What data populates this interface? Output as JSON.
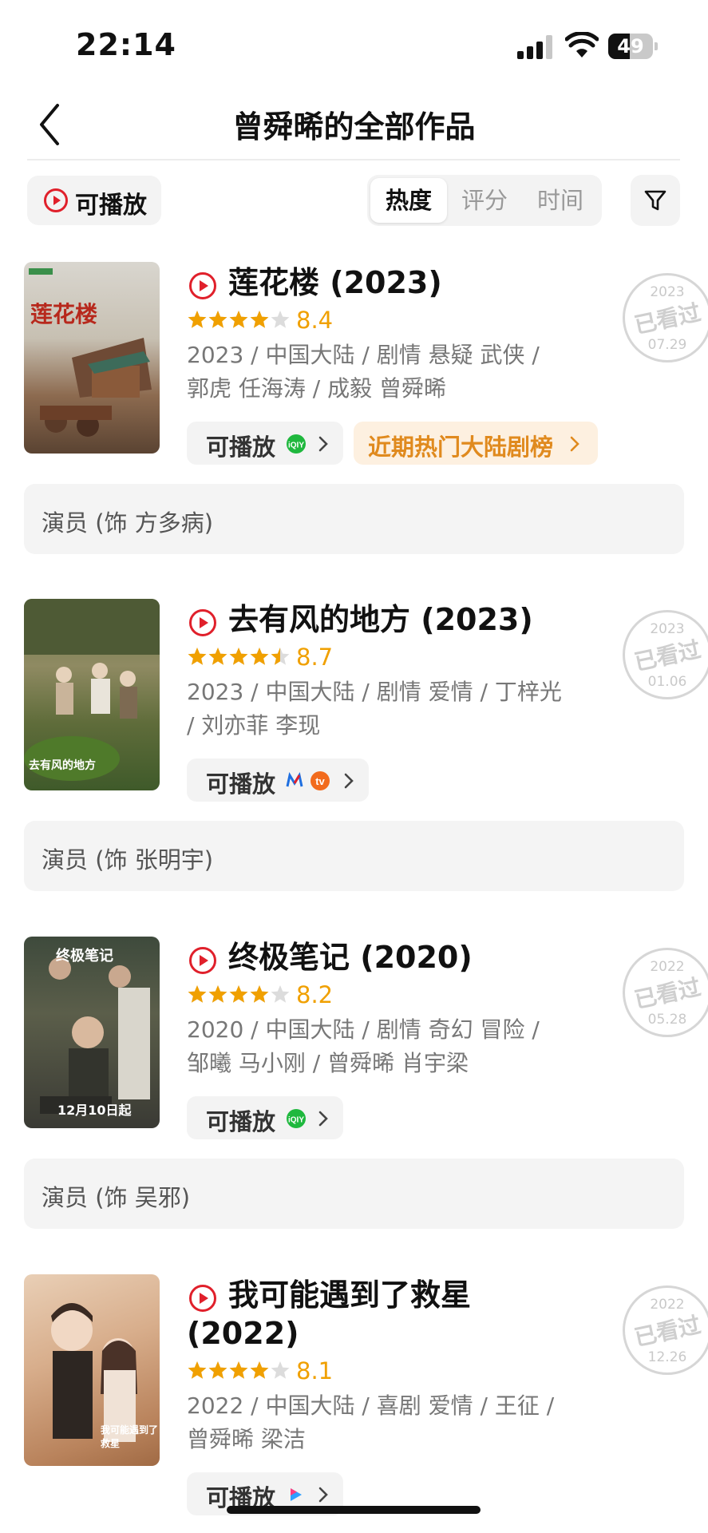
{
  "status_bar": {
    "time": "22:14",
    "battery": "49",
    "battery_level": 0.49
  },
  "nav": {
    "title": "曾舜晞的全部作品"
  },
  "filters": {
    "playable_label": "可播放",
    "sort_tabs": [
      {
        "label": "热度",
        "active": true
      },
      {
        "label": "评分",
        "active": false
      },
      {
        "label": "时间",
        "active": false
      }
    ]
  },
  "works": [
    {
      "title": "莲花楼 (2023)",
      "score": "8.4",
      "stars": 4,
      "meta": "2023 / 中国大陆 / 剧情 悬疑 武侠 / 郭虎 任海涛 / 成毅 曾舜晞",
      "play_label": "可播放",
      "rank_label": "近期热门大陆剧榜",
      "role": "演员 (饰 方多病)",
      "stamp": {
        "year": "2023",
        "text": "已看过",
        "date": "07.29"
      },
      "poster_text": "莲花楼"
    },
    {
      "title": "去有风的地方 (2023)",
      "score": "8.7",
      "stars": 4.5,
      "meta": "2023 / 中国大陆 / 剧情 爱情 / 丁梓光 / 刘亦菲 李现",
      "play_label": "可播放",
      "role": "演员 (饰 张明宇)",
      "stamp": {
        "year": "2023",
        "text": "已看过",
        "date": "01.06"
      },
      "poster_text": "去有风的地方"
    },
    {
      "title": "终极笔记 (2020)",
      "score": "8.2",
      "stars": 4,
      "meta": "2020 / 中国大陆 / 剧情 奇幻 冒险 / 邹曦 马小刚 / 曾舜晞 肖宇梁",
      "play_label": "可播放",
      "role": "演员 (饰 吴邪)",
      "stamp": {
        "year": "2022",
        "text": "已看过",
        "date": "05.28"
      },
      "poster_text": "终极笔记",
      "poster_date": "12月10日起"
    },
    {
      "title": "我可能遇到了救星 (2022)",
      "score": "8.1",
      "stars": 4,
      "meta": "2022 / 中国大陆 / 喜剧 爱情 / 王征 / 曾舜晞 梁洁",
      "play_label": "可播放",
      "stamp": {
        "year": "2022",
        "text": "已看过",
        "date": "12.26"
      },
      "poster_text": "我可能遇到了救星"
    }
  ],
  "colors": {
    "accent_red": "#e0202b",
    "star": "#f0a000",
    "rank_text": "#e08a1e"
  }
}
